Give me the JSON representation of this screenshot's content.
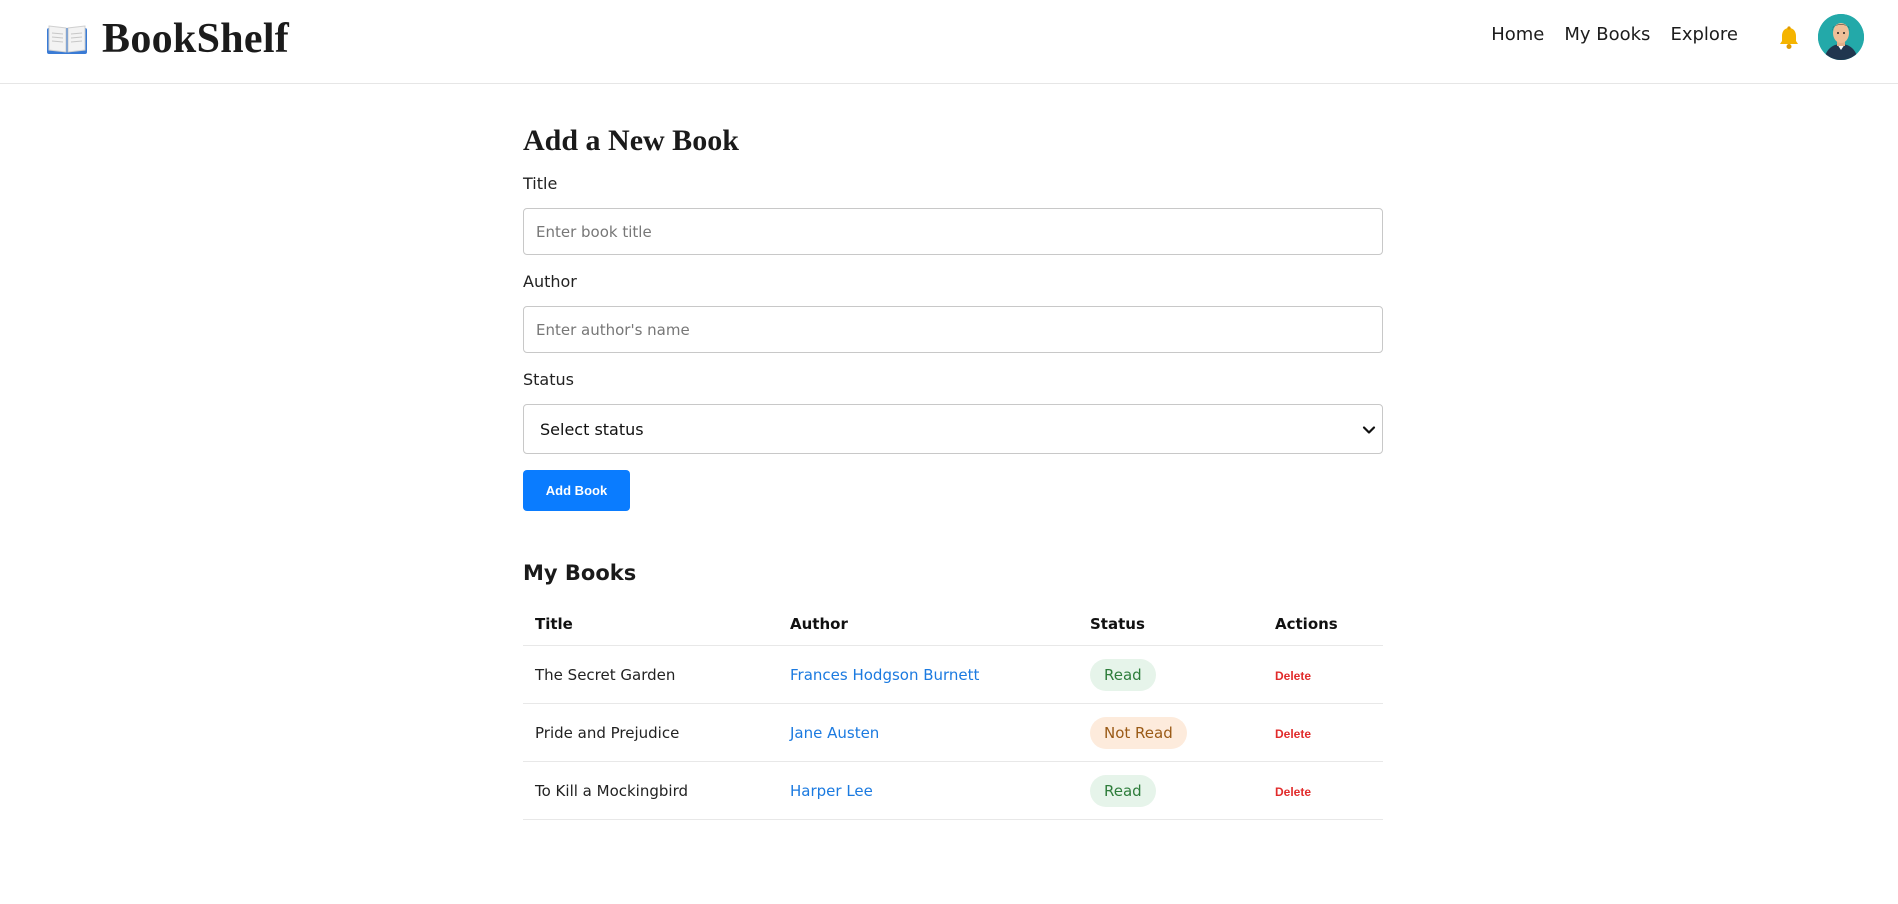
{
  "header": {
    "brand": "BookShelf",
    "nav": [
      {
        "label": "Home"
      },
      {
        "label": "My Books"
      },
      {
        "label": "Explore"
      }
    ]
  },
  "form": {
    "heading": "Add a New Book",
    "title_label": "Title",
    "title_placeholder": "Enter book title",
    "title_value": "",
    "author_label": "Author",
    "author_placeholder": "Enter author's name",
    "author_value": "",
    "status_label": "Status",
    "status_selected": "Select status",
    "submit_label": "Add Book"
  },
  "books": {
    "heading": "My Books",
    "columns": [
      "Title",
      "Author",
      "Status",
      "Actions"
    ],
    "rows": [
      {
        "title": "The Secret Garden",
        "author": "Frances Hodgson Burnett",
        "status": "Read",
        "action": "Delete"
      },
      {
        "title": "Pride and Prejudice",
        "author": "Jane Austen",
        "status": "Not Read",
        "action": "Delete"
      },
      {
        "title": "To Kill a Mockingbird",
        "author": "Harper Lee",
        "status": "Read",
        "action": "Delete"
      }
    ]
  },
  "colors": {
    "accent": "#0a7cff",
    "read_bg": "#e6f4ea",
    "read_fg": "#2e7d3b",
    "notread_bg": "#fdebdc",
    "notread_fg": "#9a5a16",
    "delete": "#e12b2b",
    "link": "#1b7ae0"
  },
  "icons": {
    "logo": "open-book-icon",
    "notifications": "bell-icon",
    "profile": "avatar"
  }
}
